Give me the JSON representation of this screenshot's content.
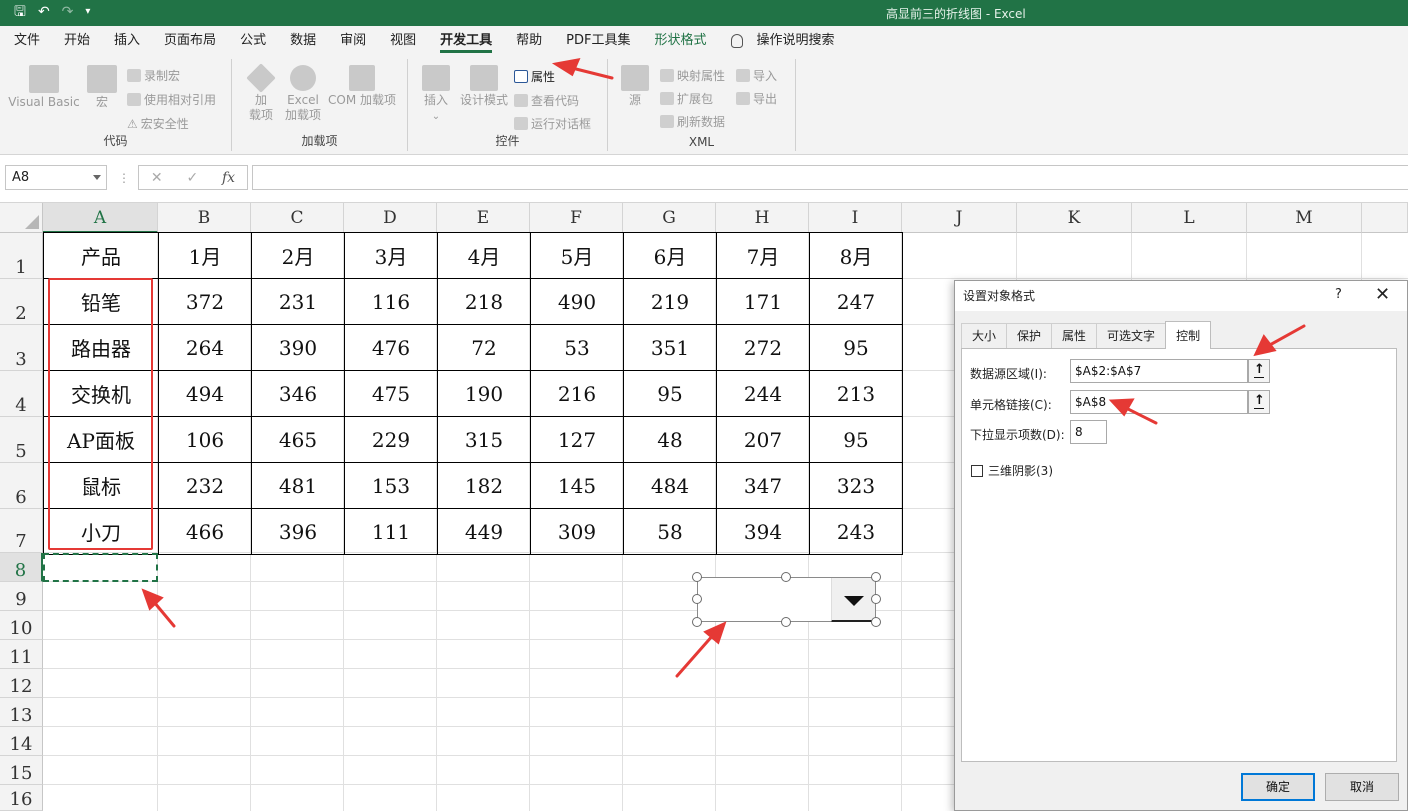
{
  "window": {
    "title": "高显前三的折线图  -  Excel"
  },
  "ribbon_tabs": [
    "文件",
    "开始",
    "插入",
    "页面布局",
    "公式",
    "数据",
    "审阅",
    "视图",
    "开发工具",
    "帮助",
    "PDF工具集",
    "形状格式"
  ],
  "active_tab": "开发工具",
  "tell_me": "操作说明搜索",
  "ribbon": {
    "code": {
      "label": "代码",
      "visual_basic": "Visual Basic",
      "macros": "宏",
      "record_macro": "录制宏",
      "relative_refs": "使用相对引用",
      "macro_security": "宏安全性"
    },
    "addins": {
      "label": "加载项",
      "addins_line1": "加",
      "addins_line2": "载项",
      "excel_addins_line1": "Excel",
      "excel_addins_line2": "加载项",
      "com_addins": "COM 加载项"
    },
    "controls": {
      "label": "控件",
      "insert": "插入",
      "design_mode": "设计模式",
      "properties": "属性",
      "view_code": "查看代码",
      "run_dialog": "运行对话框"
    },
    "xml": {
      "label": "XML",
      "source": "源",
      "map_properties": "映射属性",
      "expansion_packs": "扩展包",
      "refresh_data": "刷新数据",
      "import": "导入",
      "export": "导出"
    }
  },
  "formula_bar": {
    "name_box": "A8",
    "fx": "fx",
    "content": ""
  },
  "columns": [
    "A",
    "B",
    "C",
    "D",
    "E",
    "F",
    "G",
    "H",
    "I",
    "J",
    "K",
    "L",
    "M"
  ],
  "rows": [
    "1",
    "2",
    "3",
    "4",
    "5",
    "6",
    "7",
    "8",
    "9",
    "10",
    "11",
    "12",
    "13",
    "14",
    "15",
    "16"
  ],
  "table": {
    "header": [
      "产品",
      "1月",
      "2月",
      "3月",
      "4月",
      "5月",
      "6月",
      "7月",
      "8月"
    ],
    "rows": [
      [
        "铅笔",
        "372",
        "231",
        "116",
        "218",
        "490",
        "219",
        "171",
        "247"
      ],
      [
        "路由器",
        "264",
        "390",
        "476",
        "72",
        "53",
        "351",
        "272",
        "95"
      ],
      [
        "交换机",
        "494",
        "346",
        "475",
        "190",
        "216",
        "95",
        "244",
        "213"
      ],
      [
        "AP面板",
        "106",
        "465",
        "229",
        "315",
        "127",
        "48",
        "207",
        "95"
      ],
      [
        "鼠标",
        "232",
        "481",
        "153",
        "182",
        "145",
        "484",
        "347",
        "323"
      ],
      [
        "小刀",
        "466",
        "396",
        "111",
        "449",
        "309",
        "58",
        "394",
        "243"
      ]
    ]
  },
  "dialog": {
    "title": "设置对象格式",
    "help": "?",
    "close": "✕",
    "tabs": [
      "大小",
      "保护",
      "属性",
      "可选文字",
      "控制"
    ],
    "active_tab": "控制",
    "input_range_label": "数据源区域(I):",
    "input_range_value": "$A$2:$A$7",
    "cell_link_label": "单元格链接(C):",
    "cell_link_value": "$A$8",
    "dropdown_lines_label": "下拉显示项数(D):",
    "dropdown_lines_value": "8",
    "shading_label": "三维阴影(3)",
    "ok": "确定",
    "cancel": "取消"
  },
  "colors": {
    "excel_green": "#217346",
    "annotation_red": "#e53935",
    "dialog_primary": "#0078d7"
  }
}
